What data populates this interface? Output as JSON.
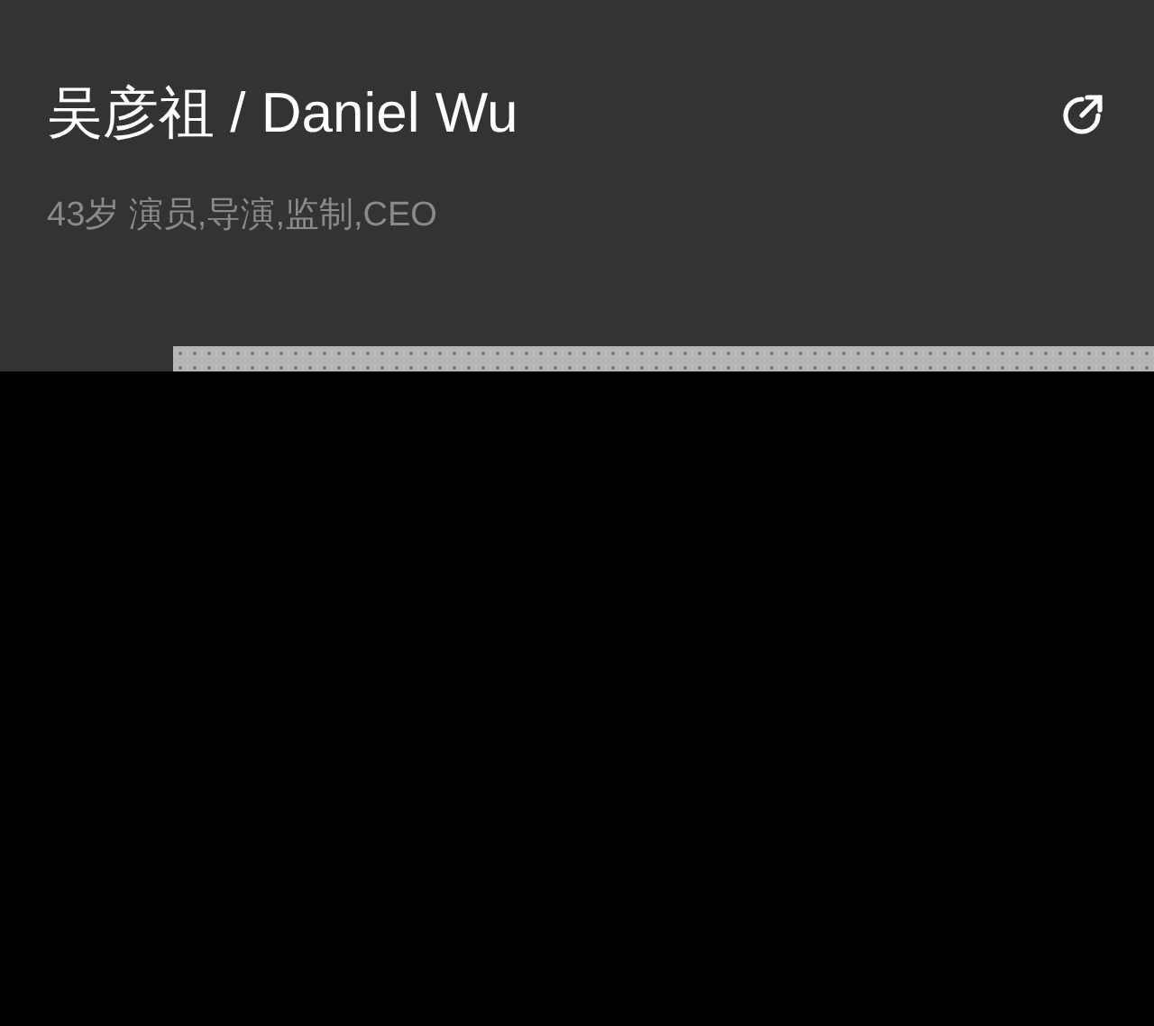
{
  "header": {
    "title": "吴彦祖 / Daniel Wu",
    "subtitle": "43岁 演员,导演,监制,CEO"
  }
}
